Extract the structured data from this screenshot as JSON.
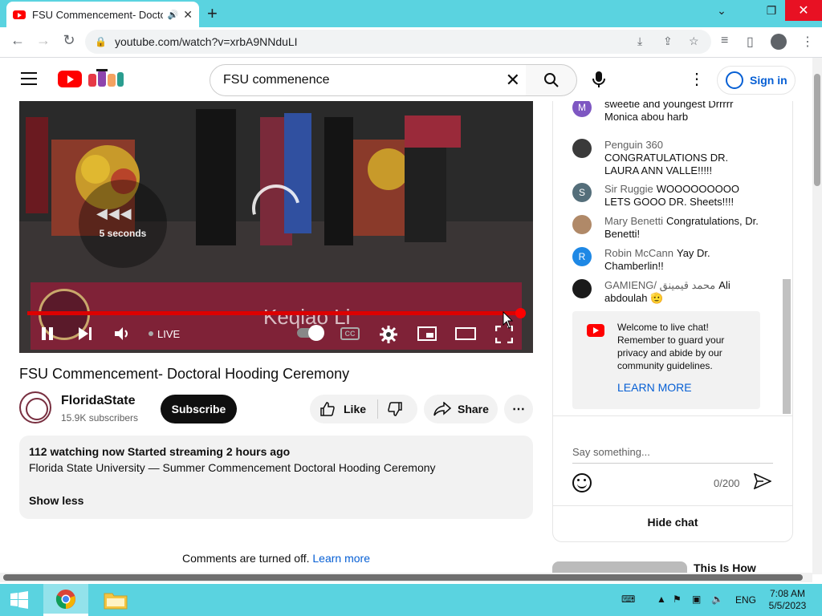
{
  "browser": {
    "tab_title": "FSU Commencement- Doctoral Hooding Ceremony",
    "tab_audio_icon": "speaker-icon",
    "new_tab_symbol": "+",
    "url": "youtube.com/watch?v=xrbA9NNduLI",
    "window_controls": [
      "chevron-down-icon",
      "restore-icon",
      "close-icon"
    ]
  },
  "youtube_header": {
    "search_value": "FSU commenence",
    "sign_in_label": "Sign in"
  },
  "player": {
    "seek_label": "5 seconds",
    "lower_third_name": "Keqiao Li",
    "live_label": "LIVE",
    "cc_label": "CC",
    "progress_fraction": 0.99
  },
  "video": {
    "title": "FSU Commencement- Doctoral Hooding Ceremony",
    "channel_name": "FloridaState",
    "subscribers": "15.9K subscribers",
    "subscribe_label": "Subscribe",
    "like_label": "Like",
    "share_label": "Share",
    "more_label": "⋯"
  },
  "description": {
    "meta": "112 watching now  Started streaming 2 hours ago",
    "text": "Florida State University — Summer Commencement Doctoral Hooding Ceremony",
    "show_less": "Show less"
  },
  "comments": {
    "off_text": "Comments are turned off.",
    "learn_more": "Learn more"
  },
  "chat": {
    "messages": [
      {
        "initial": "M",
        "author": "",
        "text": "sweetie and youngest Drrrrr Monica abou harb",
        "color": "#7e57c2"
      },
      {
        "initial": "",
        "author": "Penguin 360",
        "text": "CONGRATULATIONS DR. LAURA ANN VALLE!!!!!",
        "color": "#3a3a3a"
      },
      {
        "initial": "S",
        "author": "Sir Ruggie",
        "text": "WOOOOOOOOO LETS GOOO DR. Sheets!!!!",
        "color": "#546e7a"
      },
      {
        "initial": "",
        "author": "Mary Benetti",
        "text": "Congratulations, Dr. Benetti!",
        "color": "#b08968"
      },
      {
        "initial": "R",
        "author": "Robin McCann",
        "text": "Yay Dr. Chamberlin!!",
        "color": "#1e88e5"
      },
      {
        "initial": "",
        "author": "GAMIENG/ محمد قيمينق",
        "text": "Ali abdoulah 🫡",
        "color": "#1a1a1a"
      }
    ],
    "welcome_text": "Welcome to live chat! Remember to guard your privacy and abide by our community guidelines.",
    "learn_more": "LEARN MORE",
    "input_placeholder": "Say something...",
    "char_counter": "0/200",
    "hide_chat": "Hide chat"
  },
  "up_next": {
    "title": "This Is How"
  },
  "taskbar": {
    "language": "ENG",
    "time": "7:08 AM",
    "date": "5/5/2023"
  }
}
